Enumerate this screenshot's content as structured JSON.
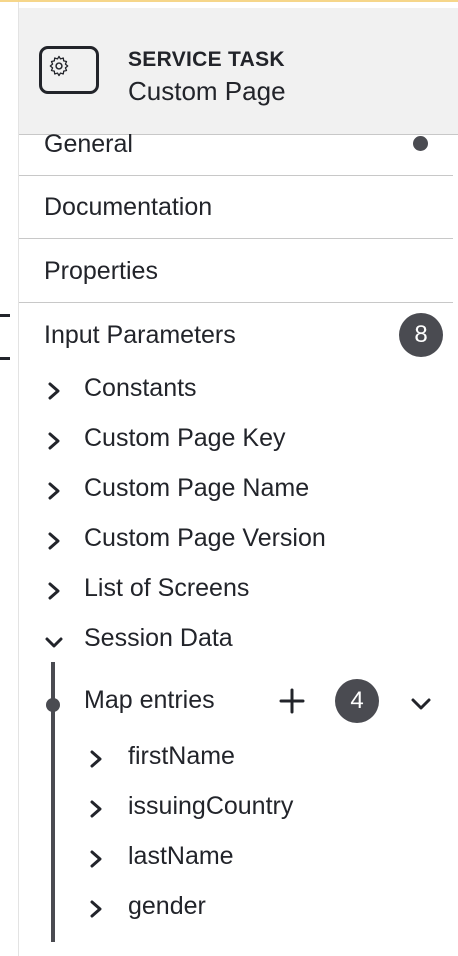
{
  "header": {
    "type": "SERVICE TASK",
    "name": "Custom Page",
    "icon": "gear-icon"
  },
  "groups": [
    {
      "label": "General",
      "indicator": "dot"
    },
    {
      "label": "Documentation"
    },
    {
      "label": "Properties"
    },
    {
      "label": "Input Parameters",
      "badge": "8"
    }
  ],
  "input_parameters": {
    "items": [
      {
        "label": "Constants",
        "expanded": false
      },
      {
        "label": "Custom Page Key",
        "expanded": false
      },
      {
        "label": "Custom Page Name",
        "expanded": false
      },
      {
        "label": "Custom Page Version",
        "expanded": false
      },
      {
        "label": "List of Screens",
        "expanded": false
      },
      {
        "label": "Session Data",
        "expanded": true
      }
    ],
    "map_entries": {
      "label": "Map entries",
      "count": "4",
      "entries": [
        "firstName",
        "issuingCountry",
        "lastName",
        "gender"
      ]
    }
  },
  "colors": {
    "text": "#22242a",
    "badge": "#4a4b51",
    "header_bg": "#f1f1f1",
    "accent": "#f6d68a"
  }
}
